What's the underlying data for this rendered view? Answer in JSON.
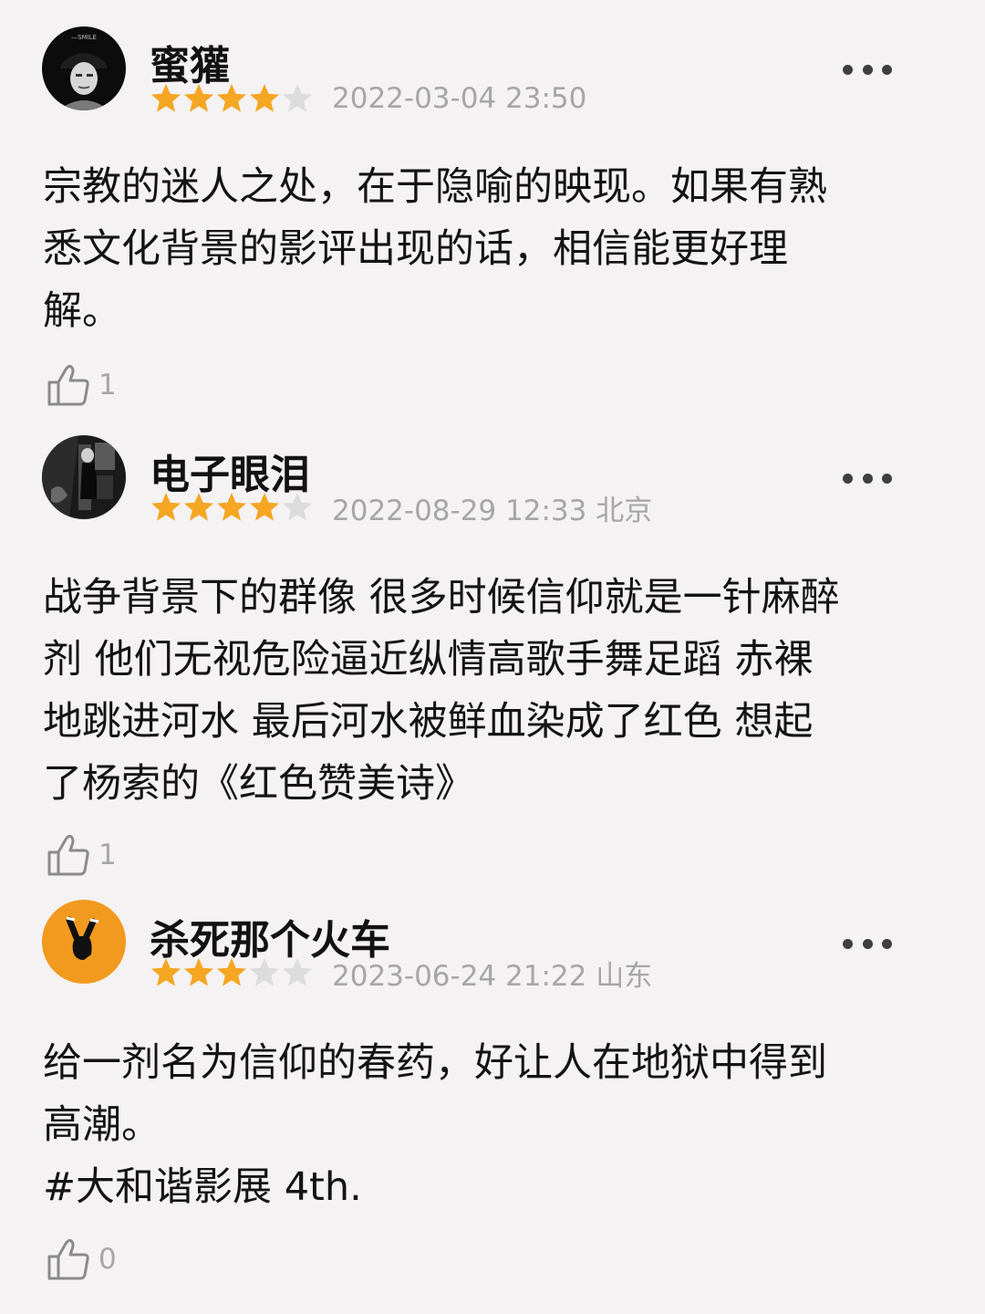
{
  "comments": [
    {
      "username": "蜜獾",
      "rating": 4,
      "max_rating": 5,
      "meta": "2022-03-04 23:50",
      "avatar_label": "—SMILE",
      "lines": [
        "宗教的迷人之处，在于隐喻的映现。如果有熟",
        "悉文化背景的影评出现的话，相信能更好理",
        "解。"
      ],
      "likes": "1"
    },
    {
      "username": "电子眼泪",
      "rating": 4,
      "max_rating": 5,
      "meta": "2022-08-29 12:33 北京",
      "lines": [
        "战争背景下的群像 很多时候信仰就是一针麻醉",
        "剂 他们无视危险逼近纵情高歌手舞足蹈 赤裸",
        "地跳进河水 最后河水被鲜血染成了红色 想起",
        "了杨索的《红色赞美诗》"
      ],
      "likes": "1"
    },
    {
      "username": "杀死那个火车",
      "rating": 3,
      "max_rating": 5,
      "meta": "2023-06-24 21:22 山东",
      "lines": [
        "给一剂名为信仰的春药，好让人在地狱中得到",
        "高潮。",
        "#大和谐影展 4th."
      ],
      "likes": "0"
    }
  ],
  "colors": {
    "star_filled": "#f5a623",
    "star_empty": "#dcdcdc",
    "meta_text": "#a6a6a6",
    "background": "#f4f2f3"
  },
  "icons": {
    "more": "more-icon",
    "like": "thumbs-up-icon",
    "star": "star-icon"
  }
}
